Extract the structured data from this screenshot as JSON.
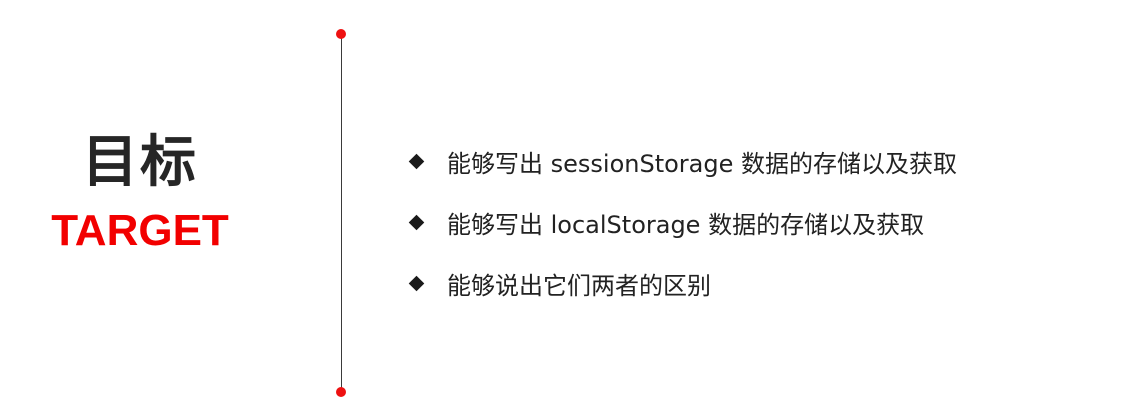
{
  "heading": {
    "title_cn": "目标",
    "title_en": "TARGET"
  },
  "goals": [
    {
      "text": "能够写出 sessionStorage 数据的存储以及获取"
    },
    {
      "text": "能够写出 localStorage 数据的存储以及获取"
    },
    {
      "text": "能够说出它们两者的区别"
    }
  ],
  "colors": {
    "accent": "#f20000",
    "heading": "#262626",
    "text": "#222222",
    "divider": "#3a3a3a"
  }
}
